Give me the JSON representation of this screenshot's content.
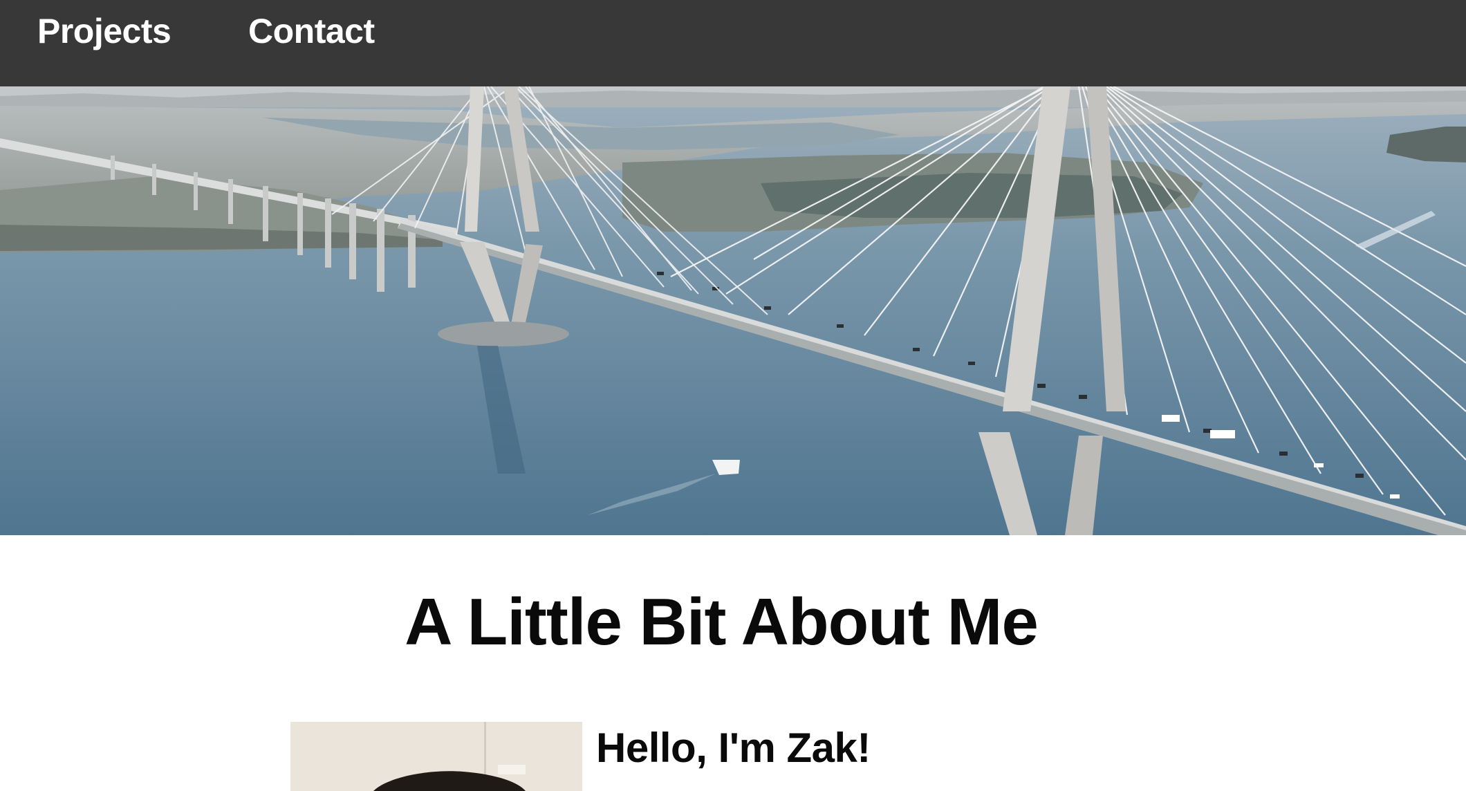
{
  "nav": {
    "items": [
      {
        "label": "Projects"
      },
      {
        "label": "Contact"
      }
    ]
  },
  "hero": {
    "image": "aerial-bridge-photo"
  },
  "about": {
    "title": "A Little Bit About Me",
    "greeting": "Hello, I'm Zak!",
    "portrait_image": "profile-photo"
  },
  "colors": {
    "nav_background": "#383838",
    "nav_text": "#ffffff",
    "page_background": "#ffffff",
    "heading_text": "#0a0a0a",
    "water": "#6f8ea4"
  }
}
